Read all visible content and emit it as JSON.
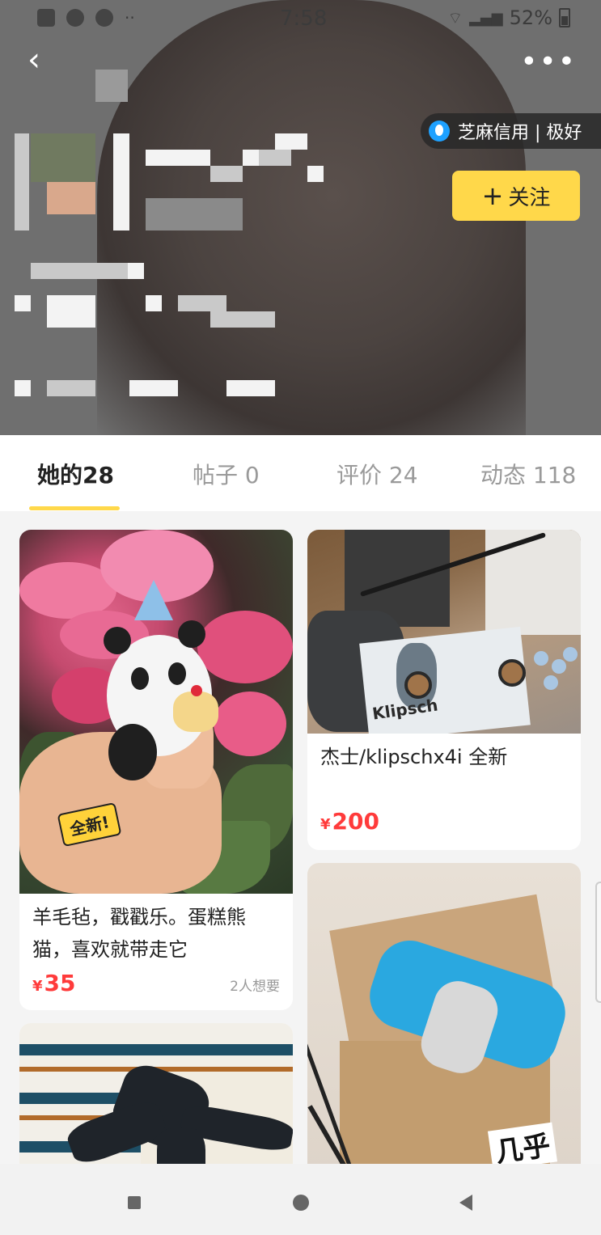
{
  "status_bar": {
    "time": "7:58",
    "battery": "52%"
  },
  "header": {
    "credit_label": "芝麻信用 | 极好",
    "follow_label": "关注"
  },
  "tabs": [
    {
      "label": "她的28",
      "active": true
    },
    {
      "label": "帖子 0",
      "active": false
    },
    {
      "label": "评价 24",
      "active": false
    },
    {
      "label": "动态 118",
      "active": false
    }
  ],
  "items": [
    {
      "title_line1": "羊毛毡，戳戳乐。蛋糕熊",
      "title_line2": "猫，喜欢就带走它",
      "price_symbol": "¥",
      "price": "35",
      "wants": "2人想要",
      "badge": "全新!"
    },
    {
      "title_line1": "杰士/klipschx4i 全新",
      "price_symbol": "¥",
      "price": "200",
      "image_text": "Klipsch"
    },
    {
      "badge": "几乎"
    }
  ],
  "colors": {
    "accent": "#ffd84a",
    "price": "#ff3b3b"
  }
}
